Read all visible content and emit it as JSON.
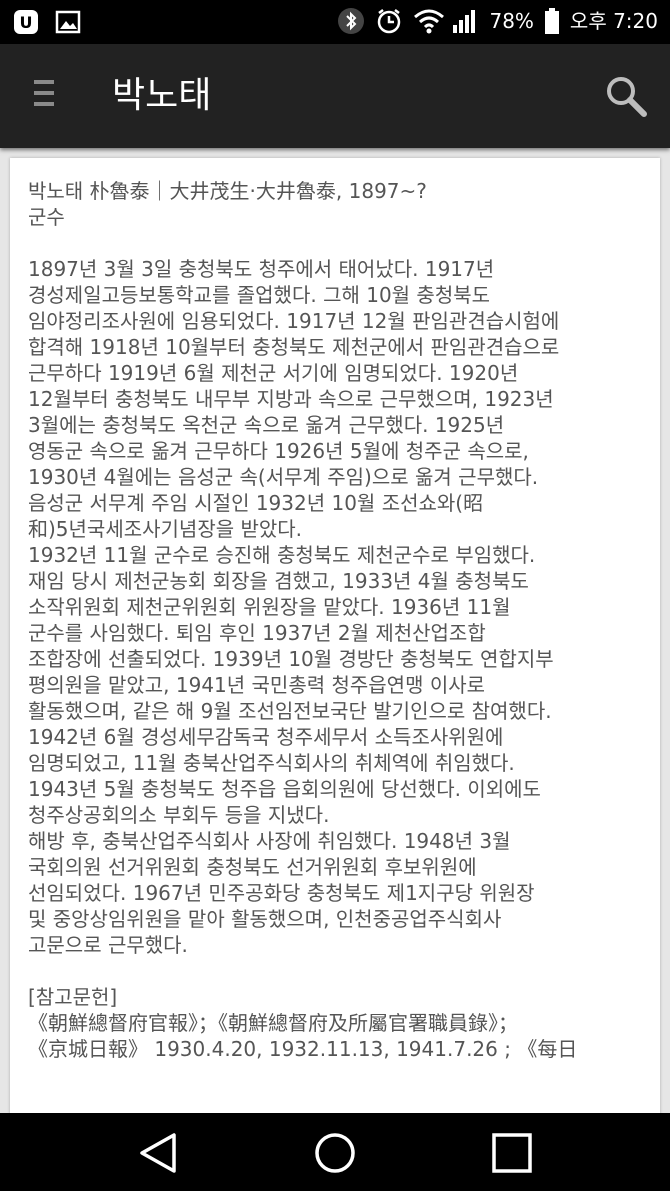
{
  "status_bar": {
    "battery": "78%",
    "time": "오후 7:20"
  },
  "app_bar": {
    "title": "박노태"
  },
  "article": {
    "heading_line1": "박노태 朴魯泰｜大井茂生·大井魯泰, 1897~?",
    "heading_line2": "군수",
    "body": [
      "1897년 3월 3일 충청북도 청주에서 태어났다. 1917년",
      "경성제일고등보통학교를 졸업했다. 그해 10월 충청북도",
      "임야정리조사원에 임용되었다. 1917년 12월 판임관견습시험에",
      "합격해 1918년 10월부터 충청북도 제천군에서 판임관견습으로",
      "근무하다 1919년 6월 제천군 서기에 임명되었다. 1920년",
      "12월부터 충청북도 내무부 지방과 속으로 근무했으며, 1923년",
      "3월에는 충청북도 옥천군 속으로 옮겨 근무했다. 1925년",
      "영동군 속으로 옮겨 근무하다 1926년 5월에 청주군 속으로,",
      "1930년 4월에는 음성군 속(서무계 주임)으로 옮겨 근무했다.",
      "음성군 서무계 주임 시절인 1932년 10월 조선쇼와(昭",
      "和)5년국세조사기념장을 받았다.",
      "1932년 11월 군수로 승진해 충청북도 제천군수로 부임했다.",
      "재임 당시 제천군농회 회장을 겸했고, 1933년 4월 충청북도",
      "소작위원회 제천군위원회 위원장을 맡았다. 1936년 11월",
      "군수를 사임했다. 퇴임 후인 1937년 2월 제천산업조합",
      "조합장에 선출되었다. 1939년 10월 경방단 충청북도 연합지부",
      "평의원을 맡았고, 1941년 국민총력 청주읍연맹 이사로",
      "활동했으며, 같은 해 9월 조선임전보국단 발기인으로 참여했다.",
      "1942년 6월 경성세무감독국 청주세무서 소득조사위원에",
      "임명되었고, 11월 충북산업주식회사의 취체역에 취임했다.",
      "1943년 5월 충청북도 청주읍 읍회의원에 당선했다. 이외에도",
      "청주상공회의소 부회두 등을 지냈다.",
      "해방 후, 충북산업주식회사 사장에 취임했다. 1948년 3월",
      "국회의원 선거위원회 충청북도 선거위원회 후보위원에",
      "선임되었다. 1967년 민주공화당 충청북도 제1지구당 위원장",
      "및 중앙상임위원을 맡아 활동했으며, 인천중공업주식회사",
      "고문으로 근무했다."
    ],
    "references_title": "[참고문헌]",
    "references": [
      "《朝鮮總督府官報》；《朝鮮總督府及所屬官署職員錄》；",
      "《京城日報》 1930.4.20, 1932.11.13, 1941.7.26 ; 《每日"
    ]
  }
}
